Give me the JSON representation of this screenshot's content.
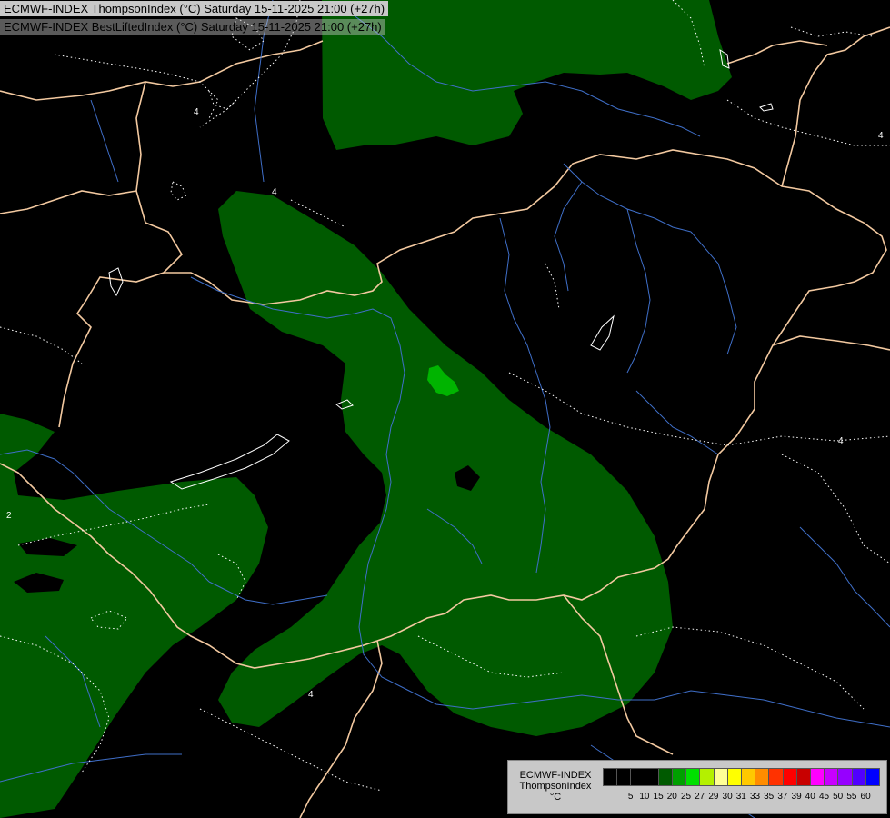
{
  "header": {
    "line1": "ECMWF-INDEX ThompsonIndex (°C) Saturday 15-11-2025 21:00 (+27h)",
    "line2": "ECMWF-INDEX BestLiftedIndex (°C) Saturday 15-11-2025 21:00 (+27h)"
  },
  "map": {
    "background_color": "#000000",
    "fill_color": "#005a00",
    "highlight_fill_color": "#00b400",
    "border_color": "#f3c9a0",
    "river_color": "#3f6fc9",
    "contour_color": "#ffffff",
    "contour_labels": [
      "4",
      "4",
      "4",
      "4",
      "4",
      "2"
    ]
  },
  "legend": {
    "title_lines": [
      "ECMWF-INDEX",
      "ThompsonIndex",
      "°C"
    ],
    "tick_labels": [
      "5",
      "10",
      "15",
      "20",
      "25",
      "27",
      "29",
      "30",
      "31",
      "33",
      "35",
      "37",
      "39",
      "40",
      "45",
      "50",
      "55",
      "60"
    ],
    "colors": [
      "#000000",
      "#000000",
      "#000000",
      "#000000",
      "#005a00",
      "#00a000",
      "#00e000",
      "#b4f000",
      "#ffff96",
      "#ffff00",
      "#ffc800",
      "#ff8c00",
      "#ff3200",
      "#ff0000",
      "#c80000",
      "#ff00ff",
      "#c800ff",
      "#9600ff",
      "#5000ff",
      "#0000ff"
    ]
  }
}
